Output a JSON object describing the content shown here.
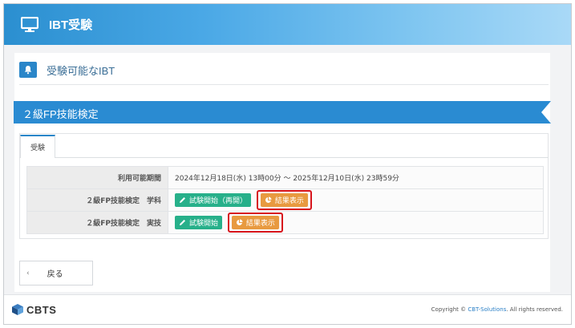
{
  "header": {
    "title": "IBT受験",
    "icon": "monitor-icon"
  },
  "section": {
    "title": "受験可能なIBT",
    "icon": "bell-icon"
  },
  "exam": {
    "name": "２級FP技能検定",
    "tab_label": "受験",
    "period_label": "利用可能期間",
    "period_value": "2024年12月18日(水) 13時00分 〜 2025年12月10日(水) 23時59分",
    "rows": [
      {
        "label": "２級FP技能検定　学科",
        "start_label": "試験開始（再開）",
        "result_label": "結果表示"
      },
      {
        "label": "２級FP技能検定　実技",
        "start_label": "試験開始",
        "result_label": "結果表示"
      }
    ]
  },
  "back": {
    "chevron": "‹",
    "label": "戻る"
  },
  "footer": {
    "logo_text": "CBTS",
    "copyright_prefix": "Copyright © ",
    "copyright_link": "CBT-Solutions",
    "copyright_suffix": ". All rights reserved."
  },
  "colors": {
    "header_start": "#2b8fd0",
    "ribbon": "#2a8bd2",
    "start_button": "#27b08a",
    "result_button": "#e89a40",
    "highlight": "#d7141c"
  }
}
